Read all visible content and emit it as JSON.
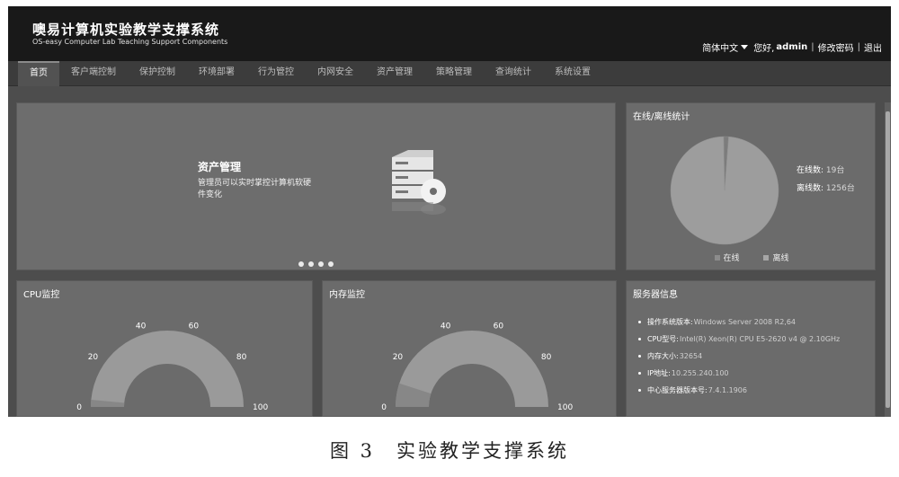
{
  "header": {
    "title": "噢易计算机实验教学支撑系统",
    "subtitle": "OS-easy Computer Lab Teaching Support Components",
    "language": "简体中文",
    "greeting": "您好,",
    "username": "admin",
    "change_password": "修改密码",
    "logout": "退出",
    "separator": "|"
  },
  "nav": {
    "items": [
      {
        "label": "首页",
        "active": true
      },
      {
        "label": "客户端控制",
        "active": false
      },
      {
        "label": "保护控制",
        "active": false
      },
      {
        "label": "环境部署",
        "active": false
      },
      {
        "label": "行为管控",
        "active": false
      },
      {
        "label": "内网安全",
        "active": false
      },
      {
        "label": "资产管理",
        "active": false
      },
      {
        "label": "策略管理",
        "active": false
      },
      {
        "label": "查询统计",
        "active": false
      },
      {
        "label": "系统设置",
        "active": false
      }
    ]
  },
  "carousel": {
    "title": "资产管理",
    "description": "管理员可以实时掌控计算机软硬件变化",
    "icon": "server-disc-icon",
    "slide_count": 4,
    "active_slide": 1
  },
  "online_stats": {
    "title": "在线/离线统计",
    "online_label": "在线数:",
    "online_value": "19台",
    "offline_label": "离线数:",
    "offline_value": "1256台",
    "legend_online": "在线",
    "legend_offline": "离线",
    "chart_data": {
      "type": "pie",
      "categories": [
        "在线",
        "离线"
      ],
      "values": [
        19,
        1256
      ]
    }
  },
  "cpu": {
    "title": "CPU监控",
    "ticks": [
      "0",
      "20",
      "40",
      "60",
      "80",
      "100"
    ],
    "tick_values": [
      0,
      20,
      40,
      60,
      80,
      100
    ],
    "value": 3
  },
  "memory": {
    "title": "内存监控",
    "ticks": [
      "0",
      "20",
      "40",
      "60",
      "80",
      "100"
    ],
    "tick_values": [
      0,
      20,
      40,
      60,
      80,
      100
    ],
    "value": 10
  },
  "server_info": {
    "title": "服务器信息",
    "items": [
      {
        "label": "操作系统版本:",
        "value": "Windows Server 2008 R2,64"
      },
      {
        "label": "CPU型号:",
        "value": "Intel(R) Xeon(R) CPU E5-2620 v4 @ 2.10GHz"
      },
      {
        "label": "内存大小:",
        "value": "32654"
      },
      {
        "label": "IP地址:",
        "value": "10.255.240.100"
      },
      {
        "label": "中心服务器版本号:",
        "value": "7.4.1.1906"
      }
    ]
  },
  "caption": "图 3　实验教学支撑系统",
  "colors": {
    "header_bg": "#191919",
    "panel_bg": "#6b6b6b",
    "gauge_track": "#9a9a9a",
    "gauge_fill": "#878787",
    "pie_online": "#7c7c7c",
    "pie_offline": "#9d9d9d"
  }
}
